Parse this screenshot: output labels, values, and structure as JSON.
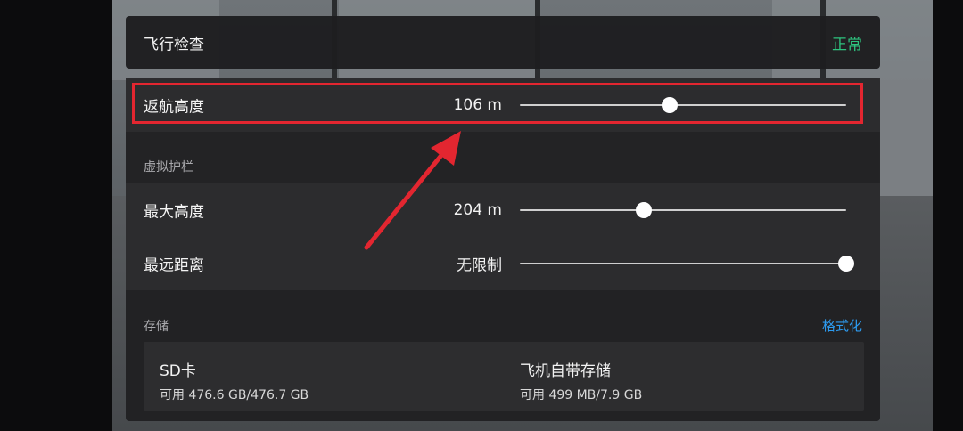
{
  "flight_check": {
    "title": "飞行检查",
    "status": "正常",
    "status_color": "#2ec27e"
  },
  "return_altitude": {
    "label": "返航高度",
    "value": "106 m",
    "slider_fraction": 0.46
  },
  "geofence": {
    "section_title": "虚拟护栏",
    "max_altitude": {
      "label": "最大高度",
      "value": "204 m",
      "slider_fraction": 0.38
    },
    "max_distance": {
      "label": "最远距离",
      "value": "无限制",
      "slider_fraction": 1.0
    }
  },
  "storage": {
    "section_title": "存储",
    "format_label": "格式化",
    "format_color": "#2d9bf0",
    "sd_card": {
      "name": "SD卡",
      "usage": "可用 476.6 GB/476.7 GB"
    },
    "internal": {
      "name": "飞机自带存储",
      "usage": "可用 499 MB/7.9 GB"
    }
  },
  "annotation": {
    "highlight_color": "#e32630"
  }
}
